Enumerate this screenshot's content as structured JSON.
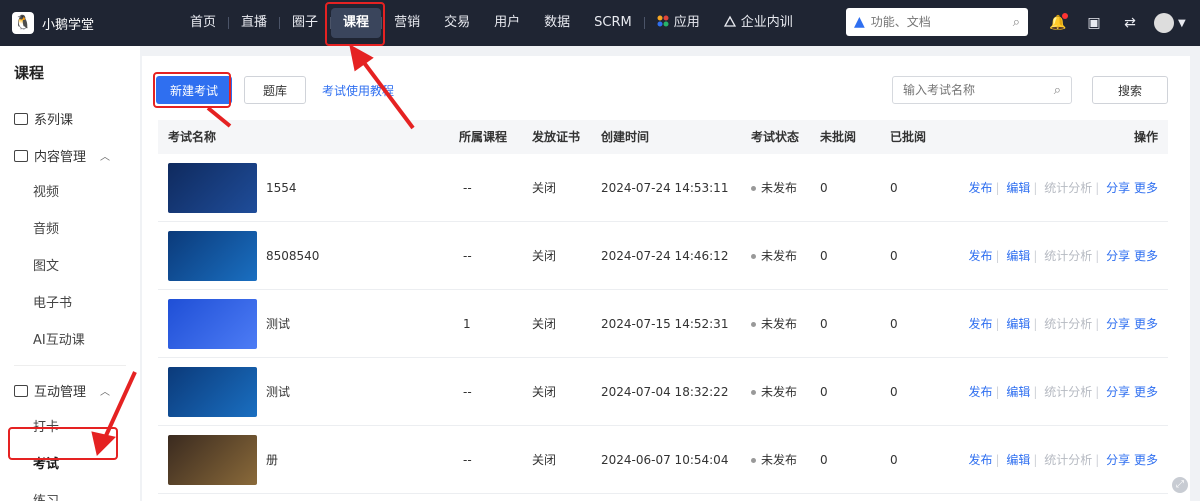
{
  "app": {
    "name": "小鹅学堂"
  },
  "nav": {
    "items": [
      {
        "label": "首页"
      },
      {
        "label": "直播"
      },
      {
        "label": "圈子"
      },
      {
        "label": "课程"
      },
      {
        "label": "营销"
      },
      {
        "label": "交易"
      },
      {
        "label": "用户"
      },
      {
        "label": "数据"
      },
      {
        "label": "SCRM"
      },
      {
        "label": "应用"
      },
      {
        "label": "企业内训"
      }
    ],
    "active": "课程"
  },
  "top_search": {
    "placeholder": "功能、文档"
  },
  "sidebar": {
    "title": "课程",
    "series_label": "系列课",
    "content_group": "内容管理",
    "content_items": [
      "视频",
      "音频",
      "图文",
      "电子书",
      "AI互动课"
    ],
    "interaction_group": "互动管理",
    "interaction_items": [
      "打卡",
      "考试",
      "练习"
    ],
    "active_item": "考试"
  },
  "toolbar": {
    "new_exam": "新建考试",
    "question_bank": "题库",
    "tutorial_link": "考试使用教程",
    "search_placeholder": "输入考试名称",
    "search_button": "搜索"
  },
  "table": {
    "headers": [
      "考试名称",
      "所属课程",
      "发放证书",
      "创建时间",
      "考试状态",
      "未批阅",
      "已批阅",
      "操作"
    ],
    "rows": [
      {
        "name": "1554",
        "course": "--",
        "cert": "关闭",
        "created": "2024-07-24 14:53:11",
        "status": "未发布",
        "unreviewed": "0",
        "reviewed": "0"
      },
      {
        "name": "8508540",
        "course": "--",
        "cert": "关闭",
        "created": "2024-07-24 14:46:12",
        "status": "未发布",
        "unreviewed": "0",
        "reviewed": "0"
      },
      {
        "name": "测试",
        "course": "1",
        "cert": "关闭",
        "created": "2024-07-15 14:52:31",
        "status": "未发布",
        "unreviewed": "0",
        "reviewed": "0"
      },
      {
        "name": "测试",
        "course": "--",
        "cert": "关闭",
        "created": "2024-07-04 18:32:22",
        "status": "未发布",
        "unreviewed": "0",
        "reviewed": "0"
      },
      {
        "name": "册",
        "course": "--",
        "cert": "关闭",
        "created": "2024-06-07 10:54:04",
        "status": "未发布",
        "unreviewed": "0",
        "reviewed": "0"
      }
    ],
    "actions": [
      "发布",
      "编辑",
      "统计分析",
      "分享",
      "更多"
    ]
  },
  "colors": {
    "topbar": "#1f2533",
    "primary": "#2f6ff0",
    "annotation": "#e52222"
  }
}
